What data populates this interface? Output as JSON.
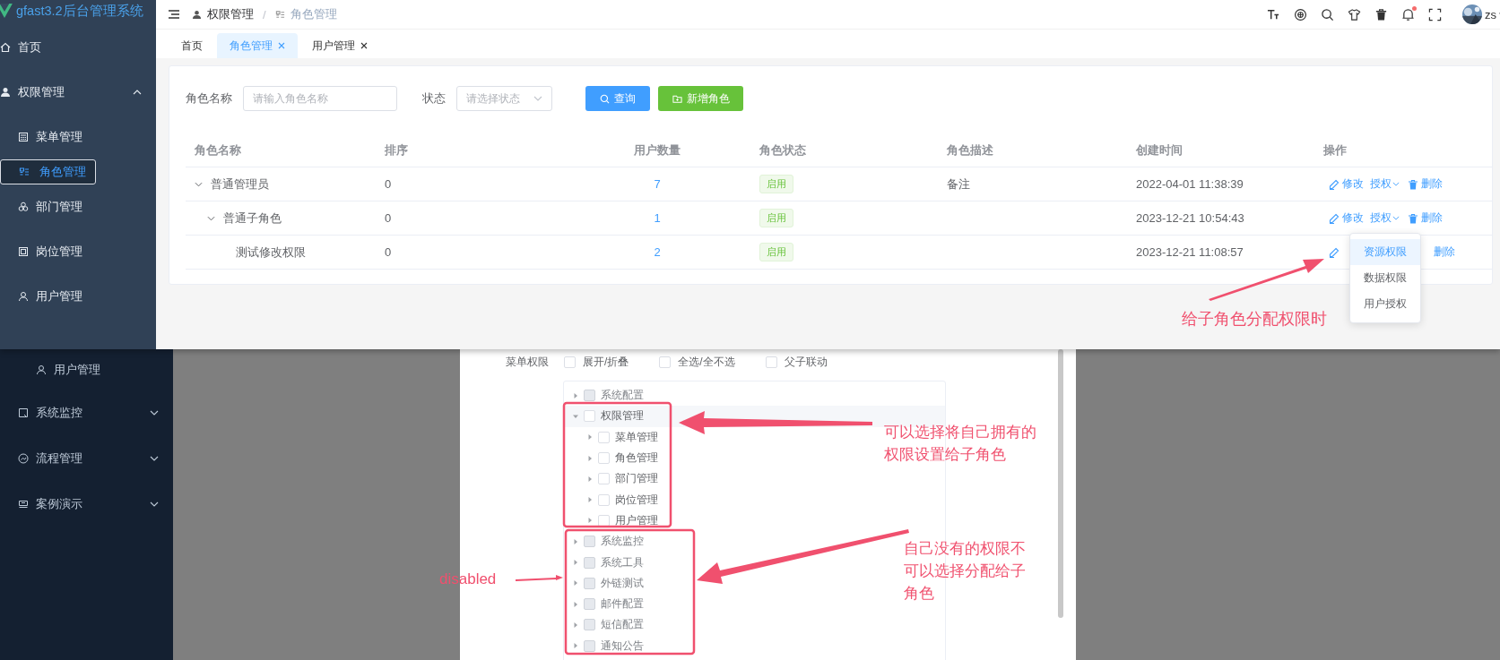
{
  "top": {
    "sidebar": {
      "title": "gfast3.2后台管理系统",
      "items": [
        {
          "label": "首页",
          "selected": false
        },
        {
          "label": "权限管理",
          "selected": false,
          "expanded": true,
          "children": [
            {
              "label": "菜单管理",
              "selected": false
            },
            {
              "label": "角色管理",
              "selected": true
            },
            {
              "label": "部门管理",
              "selected": false
            },
            {
              "label": "岗位管理",
              "selected": false
            },
            {
              "label": "用户管理",
              "selected": false
            }
          ]
        }
      ]
    },
    "header": {
      "breadcrumb": [
        "权限管理",
        "角色管理"
      ],
      "separator": "/",
      "user": "zs",
      "notification": true
    },
    "tabs": [
      {
        "label": "首页",
        "selected": false,
        "closable": false
      },
      {
        "label": "角色管理",
        "selected": true,
        "closable": true
      },
      {
        "label": "用户管理",
        "selected": false,
        "closable": true
      }
    ],
    "filters": {
      "name_label": "角色名称",
      "name_placeholder": "请输入角色名称",
      "status_label": "状态",
      "status_placeholder": "请选择状态",
      "search_button": "查询",
      "add_button": "新增角色"
    },
    "table": {
      "columns": [
        "角色名称",
        "排序",
        "用户数量",
        "角色状态",
        "角色描述",
        "创建时间",
        "操作"
      ],
      "rows": [
        {
          "name": "普通管理员",
          "sort": "0",
          "users": "7",
          "status": "启用",
          "description": "备注",
          "created": "2022-04-01 11:38:39",
          "expanded": true,
          "actions": [
            {
              "kind": "edit",
              "label": "修改"
            },
            {
              "kind": "auth",
              "label": "授权"
            },
            {
              "kind": "delete",
              "label": "删除"
            }
          ],
          "children": [
            {
              "name": "普通子角色",
              "sort": "0",
              "users": "1",
              "status": "启用",
              "created": "2023-12-21 10:54:43",
              "expanded": true,
              "actions": [
                {
                  "kind": "edit",
                  "label": "修改"
                },
                {
                  "kind": "auth",
                  "label": "授权"
                },
                {
                  "kind": "delete",
                  "label": "删除"
                }
              ],
              "children": [
                {
                  "name": "测试修改权限",
                  "sort": "0",
                  "users": "2",
                  "status": "启用",
                  "created": "2023-12-21 11:08:57",
                  "actions": [
                    {
                      "kind": "edit"
                    },
                    {
                      "kind": "delete",
                      "label": "删除"
                    }
                  ]
                }
              ]
            }
          ]
        }
      ]
    },
    "dropdown": [
      {
        "label": "资源权限",
        "selected": true
      },
      {
        "label": "数据权限",
        "selected": false
      },
      {
        "label": "用户授权",
        "selected": false
      }
    ],
    "annotation": "给子角色分配权限时"
  },
  "bottom": {
    "sidebar": [
      {
        "kind": "sub",
        "label": "用户管理"
      },
      {
        "kind": "group",
        "label": "系统监控",
        "expanded": false
      },
      {
        "kind": "group",
        "label": "流程管理",
        "expanded": false
      },
      {
        "kind": "group",
        "label": "案例演示",
        "expanded": false
      }
    ],
    "dialog": {
      "label": "菜单权限",
      "options": [
        {
          "label": "展开/折叠",
          "checked": false
        },
        {
          "label": "全选/全不选",
          "checked": false
        },
        {
          "label": "父子联动",
          "checked": false
        }
      ],
      "tree": [
        {
          "label": "系统配置",
          "checked": false,
          "disabled": true,
          "expanded": false
        },
        {
          "label": "权限管理",
          "checked": false,
          "disabled": false,
          "expanded": true,
          "children": [
            {
              "label": "菜单管理",
              "checked": false,
              "disabled": false,
              "expanded": false
            },
            {
              "label": "角色管理",
              "checked": false,
              "disabled": false,
              "expanded": false
            },
            {
              "label": "部门管理",
              "checked": false,
              "disabled": false,
              "expanded": false
            },
            {
              "label": "岗位管理",
              "checked": false,
              "disabled": false,
              "expanded": false
            },
            {
              "label": "用户管理",
              "checked": false,
              "disabled": false,
              "expanded": false
            }
          ]
        },
        {
          "label": "系统监控",
          "checked": false,
          "disabled": true,
          "expanded": false
        },
        {
          "label": "系统工具",
          "checked": false,
          "disabled": true,
          "expanded": false
        },
        {
          "label": "外链测试",
          "checked": false,
          "disabled": true,
          "expanded": false
        },
        {
          "label": "邮件配置",
          "checked": false,
          "disabled": true,
          "expanded": false
        },
        {
          "label": "短信配置",
          "checked": false,
          "disabled": true,
          "expanded": false
        },
        {
          "label": "通知公告",
          "checked": false,
          "disabled": true,
          "expanded": false
        }
      ]
    },
    "annotations": [
      "可以选择将自己拥有的权限设置给子角色",
      "自己没有的权限不可以选择分配给子角色"
    ],
    "disabled_note": "disabled"
  }
}
